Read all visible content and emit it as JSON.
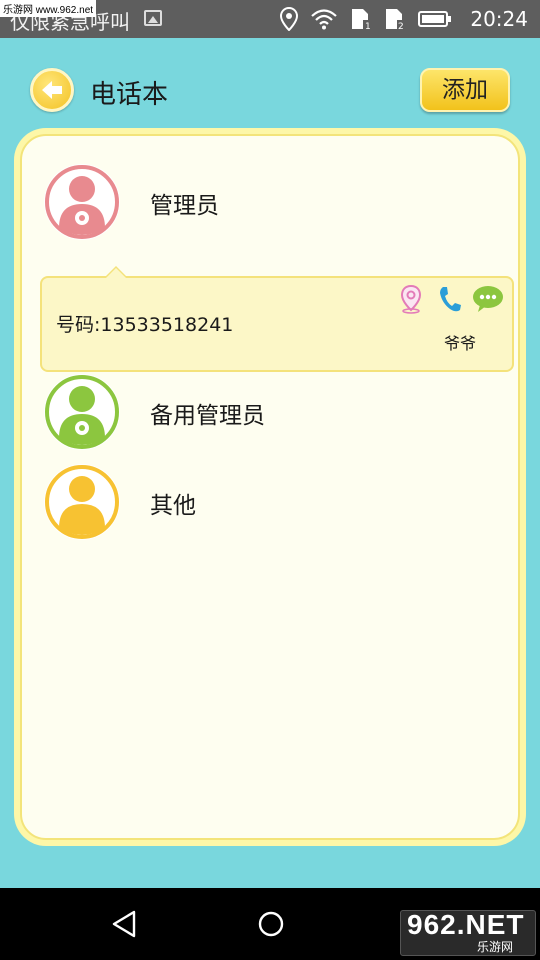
{
  "status_bar": {
    "notification_text": "仅限紧急呼叫",
    "watermark": "乐游网 www.962.net",
    "time": "20:24",
    "icons": [
      "image-icon",
      "location-icon",
      "wifi-icon",
      "sim1-icon",
      "sim2-icon",
      "battery-icon"
    ]
  },
  "header": {
    "title": "电话本",
    "add_label": "添加"
  },
  "groups": [
    {
      "label": "管理员",
      "color": "#e88a8f",
      "contacts": [
        {
          "phone_label": "号码:13533518241",
          "name": "爷爷",
          "actions": [
            "location-icon",
            "phone-icon",
            "message-icon"
          ]
        }
      ]
    },
    {
      "label": "备用管理员",
      "color": "#8cc63f"
    },
    {
      "label": "其他",
      "color": "#f7c232"
    }
  ],
  "nav": [
    "back-icon",
    "home-icon"
  ],
  "brand": {
    "big": "962.NET",
    "small": "乐游网"
  },
  "colors": {
    "background": "#79d7dd",
    "panel_border": "#fdf7a8",
    "panel_fill": "#fefef0",
    "button_yellow": "#f2c21b"
  }
}
